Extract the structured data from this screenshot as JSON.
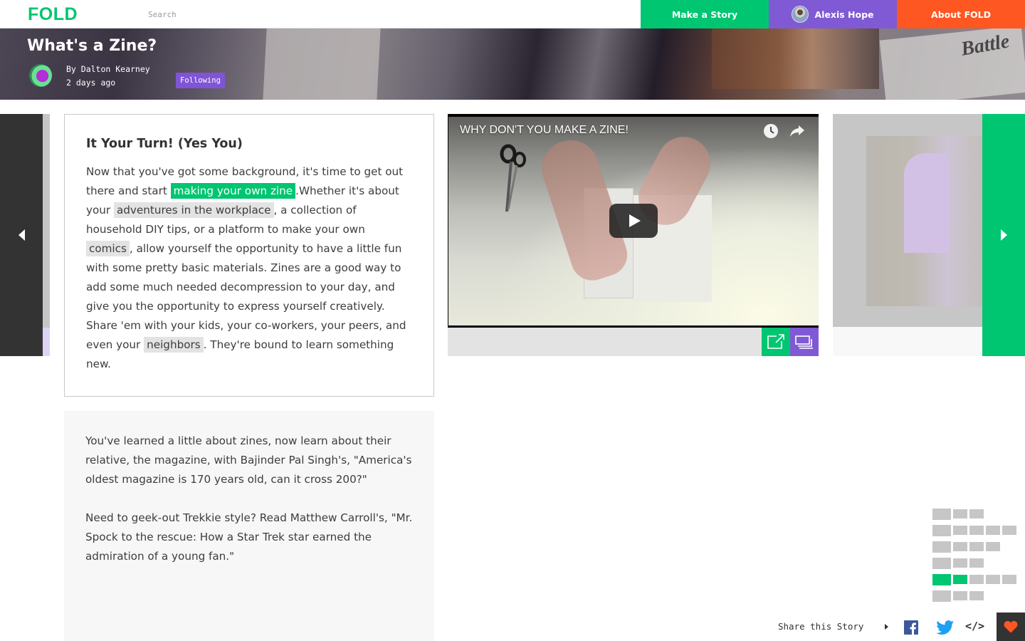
{
  "nav": {
    "logo": "FOLD",
    "search_placeholder": "Search",
    "make_story": "Make a Story",
    "user_name": "Alexis Hope",
    "about": "About FOLD",
    "colors": {
      "green": "#00c571",
      "purple": "#805ad5",
      "orange": "#ff5722"
    }
  },
  "hero": {
    "title": "What's a Zine?",
    "author": "By Dalton Kearney",
    "time": "2 days ago",
    "follow_label": "Following",
    "banner_text": "Battle"
  },
  "carousel": {
    "prev_icon": "chevron-left-icon",
    "next_icon": "chevron-right-icon"
  },
  "text_card": {
    "heading": "It Your Turn! (Yes You)",
    "segments": {
      "s1": "Now that you've got some background, it's time to get out there and start ",
      "link1": "making your own zine",
      "s2": ".Whether it's about your ",
      "link2": "adventures in the workplace",
      "s3": ", a collection of household DIY tips, or a platform to make your own ",
      "link3": "comics",
      "s4": ", allow yourself the opportunity to have a little fun with some pretty basic materials. Zines are a good way to add some much needed decompression to your day, and give you the opportunity to express yourself creatively. Share 'em with your kids, your co-workers, your peers, and even your ",
      "link4": "neighbors",
      "s5": ". They're bound to learn something new."
    }
  },
  "video_card": {
    "title": "WHY DON'T YOU MAKE A ZINE!",
    "icons": [
      "clock-icon",
      "share-arrow-icon",
      "play-icon",
      "expand-icon",
      "cards-icon"
    ]
  },
  "text_card_2": {
    "paragraphs": [
      "You've learned a little about zines, now learn about their relative, the magazine, with Bajinder Pal Singh's,  \"America's oldest magazine is 170 years old, can it cross 200?\"",
      "Need to geek-out Trekkie style? Read Matthew Carroll's,  \"Mr. Spock to the rescue: How a Star Trek star earned the admiration of a young fan.\""
    ]
  },
  "story_map": {
    "rows": [
      {
        "cards": 2,
        "active_head": false,
        "active_cards": 0
      },
      {
        "cards": 4,
        "active_head": false,
        "active_cards": 0
      },
      {
        "cards": 3,
        "active_head": false,
        "active_cards": 0
      },
      {
        "cards": 2,
        "active_head": false,
        "active_cards": 0
      },
      {
        "cards": 4,
        "active_head": true,
        "active_cards": 1
      },
      {
        "cards": 2,
        "active_head": false,
        "active_cards": 0
      }
    ]
  },
  "share": {
    "label": "Share this Story",
    "facebook_glyph": "f",
    "embed_glyph": "</>"
  }
}
